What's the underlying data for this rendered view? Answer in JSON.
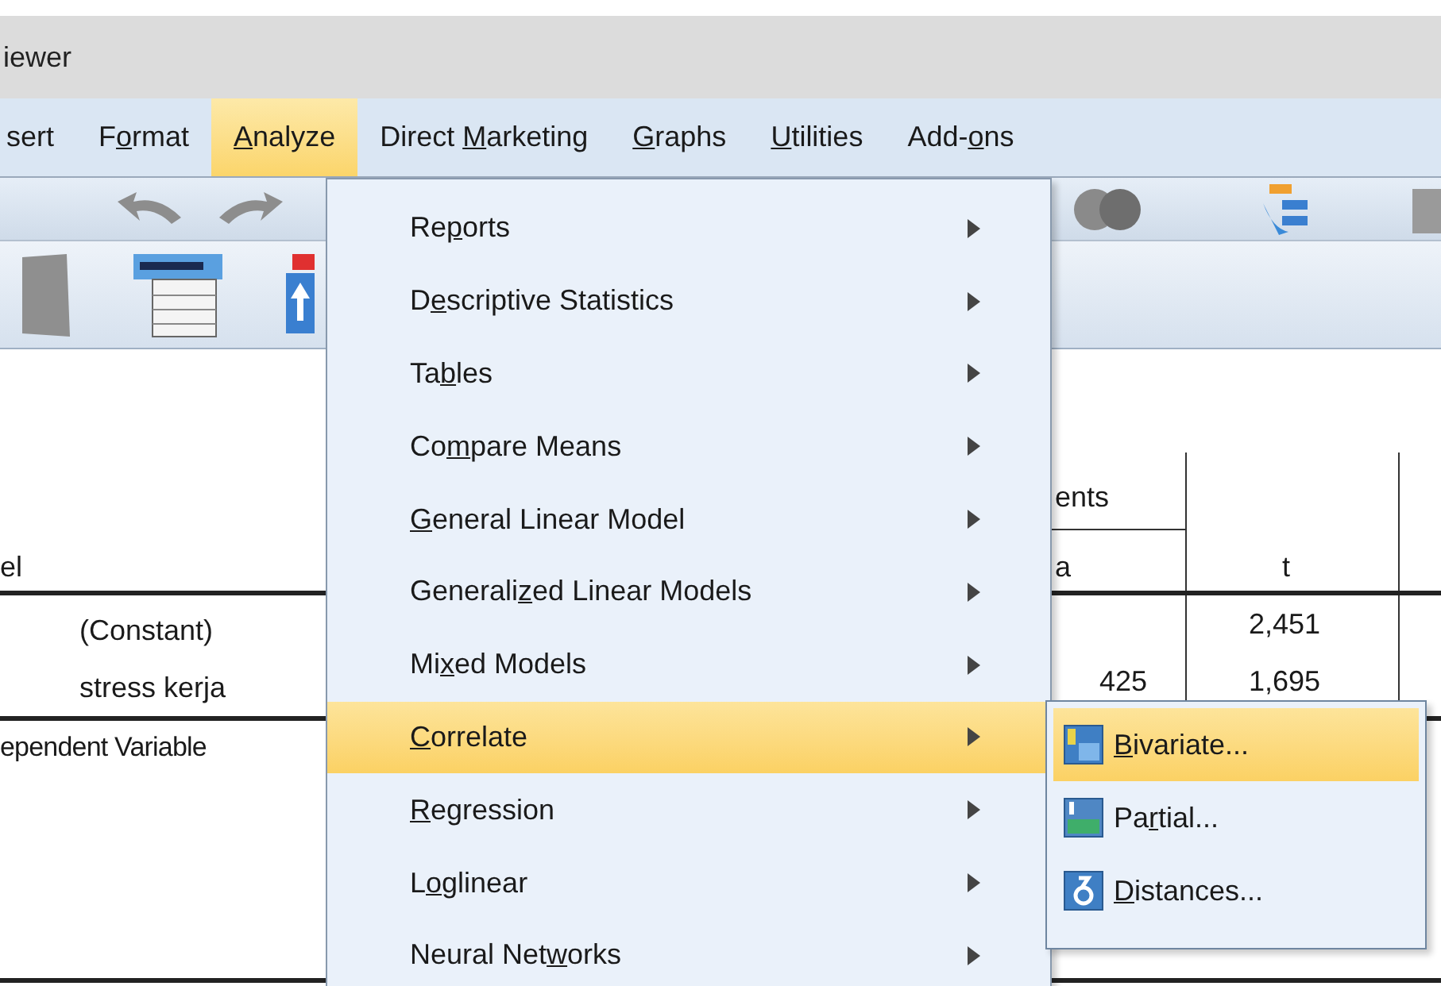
{
  "window": {
    "title": "iewer"
  },
  "menu_bar": [
    {
      "pre": "sert",
      "selected": false
    },
    {
      "pre": "F",
      "key": "o",
      "post": "rmat",
      "selected": false
    },
    {
      "key": "A",
      "post": "nalyze",
      "selected": true
    },
    {
      "pre": "Direct ",
      "key": "M",
      "post": "arketing",
      "selected": false
    },
    {
      "key": "G",
      "post": "raphs",
      "selected": false
    },
    {
      "key": "U",
      "post": "tilities",
      "selected": false
    },
    {
      "pre": "Add-",
      "key": "o",
      "post": "ns",
      "selected": false
    }
  ],
  "output_table": {
    "header_left": "el",
    "header_group": "ents",
    "header_sub": "a",
    "header_t": "t",
    "rows": [
      {
        "label": "(Constant)",
        "col_t": "2,451"
      },
      {
        "label": "stress kerja",
        "col_b": "425",
        "col_t": "1,695"
      }
    ],
    "footnote": "ependent Variable"
  },
  "analyze_menu": [
    {
      "pre": "Re",
      "key": "p",
      "post": "orts",
      "selected": false
    },
    {
      "pre": "D",
      "key": "e",
      "post": "scriptive Statistics",
      "selected": false
    },
    {
      "pre": "Ta",
      "key": "b",
      "post": "les",
      "selected": false
    },
    {
      "pre": "Co",
      "key": "m",
      "post": "pare Means",
      "selected": false
    },
    {
      "key": "G",
      "post": "eneral Linear Model",
      "selected": false
    },
    {
      "pre": "Generali",
      "key": "z",
      "post": "ed Linear Models",
      "selected": false
    },
    {
      "pre": "Mi",
      "key": "x",
      "post": "ed Models",
      "selected": false
    },
    {
      "key": "C",
      "post": "orrelate",
      "selected": true
    },
    {
      "key": "R",
      "post": "egression",
      "selected": false
    },
    {
      "pre": "L",
      "key": "o",
      "post": "glinear",
      "selected": false
    },
    {
      "pre": "Neural Net",
      "key": "w",
      "post": "orks",
      "selected": false
    }
  ],
  "correlate_submenu": [
    {
      "key": "B",
      "post": "ivariate...",
      "selected": true
    },
    {
      "pre": "Pa",
      "key": "r",
      "post": "tial...",
      "selected": false
    },
    {
      "key": "D",
      "post": "istances...",
      "selected": false
    }
  ]
}
